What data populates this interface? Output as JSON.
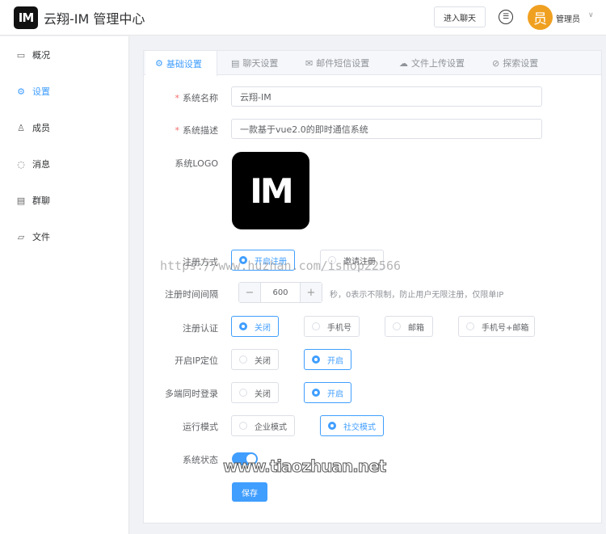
{
  "header": {
    "logo": "IM",
    "title": "云翔-IM 管理中心",
    "enter_chat": "进入聊天",
    "avatar_char": "员",
    "user_name": "管理员"
  },
  "sidebar": {
    "items": [
      {
        "icon": "chart-icon",
        "glyph": "▭",
        "label": "概况"
      },
      {
        "icon": "gear-icon",
        "glyph": "⚙",
        "label": "设置",
        "active": true
      },
      {
        "icon": "user-icon",
        "glyph": "♙",
        "label": "成员"
      },
      {
        "icon": "message-icon",
        "glyph": "◌",
        "label": "消息"
      },
      {
        "icon": "group-chat-icon",
        "glyph": "▤",
        "label": "群聊"
      },
      {
        "icon": "folder-icon",
        "glyph": "▱",
        "label": "文件"
      }
    ]
  },
  "tabs": [
    {
      "glyph": "⚙",
      "label": "基础设置",
      "active": true
    },
    {
      "glyph": "▤",
      "label": "聊天设置"
    },
    {
      "glyph": "✉",
      "label": "邮件短信设置"
    },
    {
      "glyph": "☁",
      "label": "文件上传设置"
    },
    {
      "glyph": "⊘",
      "label": "探索设置"
    }
  ],
  "form": {
    "name_label": "系统名称",
    "name_value": "云翔-IM",
    "desc_label": "系统描述",
    "desc_value": "一款基于vue2.0的即时通信系统",
    "logo_label": "系统LOGO",
    "logo_text": "IM",
    "reg_mode": {
      "label": "注册方式",
      "options": [
        "开启注册",
        "邀请注册"
      ],
      "selected": 0
    },
    "reg_interval": {
      "label": "注册时间间隔",
      "value": "600",
      "minus": "−",
      "plus": "+",
      "hint": "秒，0表示不限制，防止用户无限注册，仅限单IP"
    },
    "reg_auth": {
      "label": "注册认证",
      "options": [
        "关闭",
        "手机号",
        "邮箱",
        "手机号+邮箱"
      ],
      "selected": 0
    },
    "ip_location": {
      "label": "开启IP定位",
      "options": [
        "关闭",
        "开启"
      ],
      "selected": 1
    },
    "multi_login": {
      "label": "多端同时登录",
      "options": [
        "关闭",
        "开启"
      ],
      "selected": 1
    },
    "run_mode": {
      "label": "运行模式",
      "options": [
        "企业模式",
        "社交模式"
      ],
      "selected": 1
    },
    "status": {
      "label": "系统状态",
      "on": true
    },
    "save": "保存"
  },
  "watermarks": [
    "https://www.huzhan.com/ishop22566",
    "www.tiaozhuan.net"
  ],
  "colors": {
    "primary": "#409eff",
    "required": "#f56c6c",
    "avatar": "#f0a020"
  }
}
